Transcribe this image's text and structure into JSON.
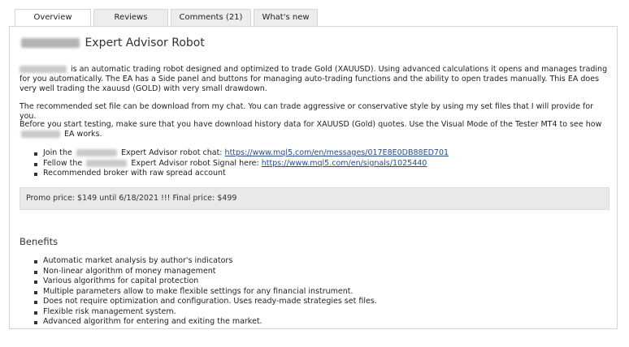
{
  "tabs": [
    {
      "label": "Overview"
    },
    {
      "label": "Reviews"
    },
    {
      "label": "Comments (21)"
    },
    {
      "label": "What's new"
    }
  ],
  "header": {
    "title_suffix": "Expert Advisor Robot"
  },
  "intro": {
    "text": "is an automatic trading robot designed and optimized to trade  Gold (XAUUSD). Using advanced calculations it opens and manages trading for you automatically. The EA has a Side panel and buttons for managing auto-trading functions and the ability to open trades manually. This EA does very well trading the xauusd (GOLD) with very small drawdown."
  },
  "setfile": {
    "text": "The recommended set file can be download from my chat. You can trade aggressive or conservative style by using my set files that I will provide for you."
  },
  "testing": {
    "text": "Before you start testing, make sure that you have download history data for XAUUSD (Gold) quotes. Use the Visual Mode of the Tester MT4 to see how",
    "suffix": "EA works."
  },
  "links": {
    "join_prefix": "Join the",
    "join_mid": "Expert Advisor robot chat:",
    "join_url": "https://www.mql5.com/en/messages/017E8E0DB88ED701",
    "follow_prefix": "Fellow the",
    "follow_mid": "Expert Advisor robot Signal here:",
    "follow_url": "https://www.mql5.com/en/signals/1025440",
    "broker": "Recommended broker with raw spread account"
  },
  "promo": {
    "text": "Promo price: $149 until 6/18/2021  !!! Final price: $499"
  },
  "benefits": {
    "heading": "Benefits",
    "items": [
      "Automatic market analysis by author's indicators",
      "Non-linear algorithm of money management",
      "Various algorithms for capital protection",
      "Multiple parameters allow to make flexible settings for any financial instrument.",
      "Does not require optimization and configuration. Uses ready-made strategies set files.",
      "Flexible risk management system.",
      "Advanced algorithm for entering and exiting the market."
    ]
  }
}
